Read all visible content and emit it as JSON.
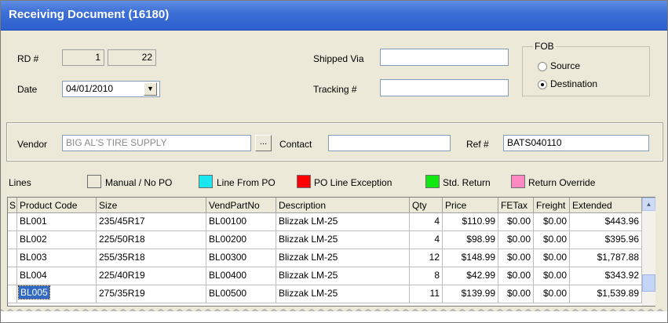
{
  "window": {
    "title": "Receiving Document (16180)"
  },
  "header": {
    "rd_label": "RD #",
    "rd_value1": "1",
    "rd_value2": "22",
    "date_label": "Date",
    "date_value": "04/01/2010",
    "shipped_via_label": "Shipped Via",
    "shipped_via_value": "",
    "tracking_label": "Tracking #",
    "tracking_value": ""
  },
  "fob": {
    "label": "FOB",
    "options": [
      {
        "label": "Source",
        "selected": false
      },
      {
        "label": "Destination",
        "selected": true
      }
    ]
  },
  "vendor": {
    "vendor_label": "Vendor",
    "vendor_value": "BIG AL'S TIRE SUPPLY",
    "browse_label": "...",
    "contact_label": "Contact",
    "contact_value": "",
    "ref_label": "Ref #",
    "ref_value": "BATS040110"
  },
  "legend": {
    "lines_label": "Lines",
    "items": [
      {
        "label": "Manual / No PO",
        "color": "#ece9d8"
      },
      {
        "label": "Line From PO",
        "color": "#1ce6f0"
      },
      {
        "label": "PO Line Exception",
        "color": "#ff0000"
      },
      {
        "label": "Std. Return",
        "color": "#11e811"
      },
      {
        "label": "Return Override",
        "color": "#ff8ac3"
      }
    ]
  },
  "table": {
    "columns": [
      "S",
      "Product Code",
      "Size",
      "VendPartNo",
      "Description",
      "Qty",
      "Price",
      "FETax",
      "Freight",
      "Extended"
    ],
    "rows": [
      [
        "",
        "BL001",
        "235/45R17",
        "BL00100",
        "Blizzak LM-25",
        "4",
        "$110.99",
        "$0.00",
        "$0.00",
        "$443.96"
      ],
      [
        "",
        "BL002",
        "225/50R18",
        "BL00200",
        "Blizzak LM-25",
        "4",
        "$98.99",
        "$0.00",
        "$0.00",
        "$395.96"
      ],
      [
        "",
        "BL003",
        "255/35R18",
        "BL00300",
        "Blizzak LM-25",
        "12",
        "$148.99",
        "$0.00",
        "$0.00",
        "$1,787.88"
      ],
      [
        "",
        "BL004",
        "225/40R19",
        "BL00400",
        "Blizzak LM-25",
        "8",
        "$42.99",
        "$0.00",
        "$0.00",
        "$343.92"
      ],
      [
        "",
        "BL005",
        "275/35R19",
        "BL00500",
        "Blizzak LM-25",
        "11",
        "$139.99",
        "$0.00",
        "$0.00",
        "$1,539.89"
      ]
    ],
    "selected_row": 4,
    "selected_color": "#316ac5"
  },
  "icons": {
    "dropdown": "chevron-down-icon",
    "scroll_up": "scroll-up-arrow-icon"
  }
}
